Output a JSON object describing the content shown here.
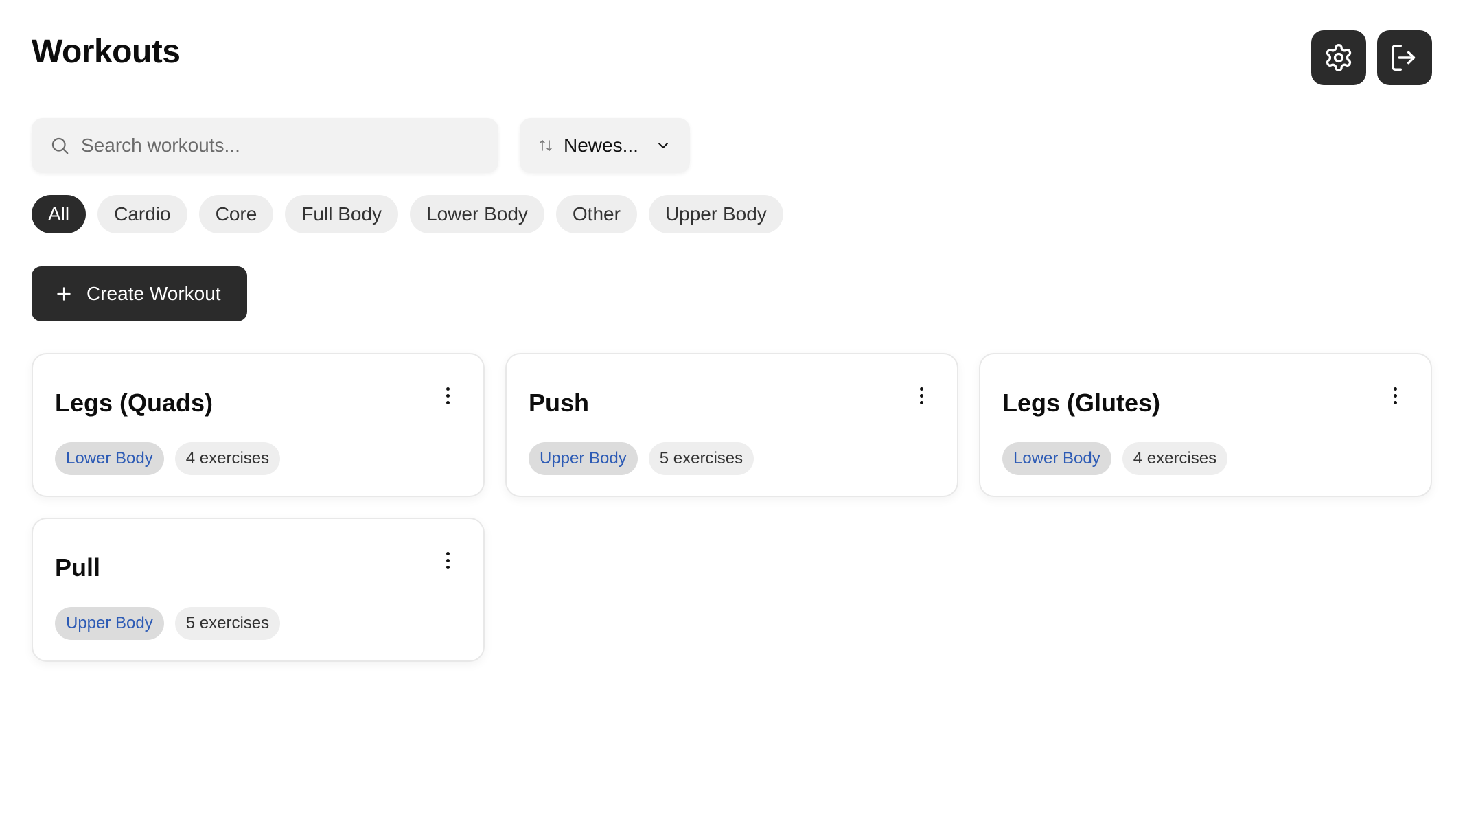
{
  "header": {
    "title": "Workouts",
    "settings_icon": "gear-icon",
    "logout_icon": "logout-icon"
  },
  "search": {
    "placeholder": "Search workouts...",
    "value": ""
  },
  "sort": {
    "label": "Newes..."
  },
  "filters": [
    {
      "label": "All",
      "active": true
    },
    {
      "label": "Cardio",
      "active": false
    },
    {
      "label": "Core",
      "active": false
    },
    {
      "label": "Full Body",
      "active": false
    },
    {
      "label": "Lower Body",
      "active": false
    },
    {
      "label": "Other",
      "active": false
    },
    {
      "label": "Upper Body",
      "active": false
    }
  ],
  "create_button": {
    "label": "Create Workout"
  },
  "workouts": [
    {
      "title": "Legs (Quads)",
      "category": "Lower Body",
      "exercises": "4 exercises"
    },
    {
      "title": "Push",
      "category": "Upper Body",
      "exercises": "5 exercises"
    },
    {
      "title": "Legs (Glutes)",
      "category": "Lower Body",
      "exercises": "4 exercises"
    },
    {
      "title": "Pull",
      "category": "Upper Body",
      "exercises": "5 exercises"
    }
  ],
  "colors": {
    "primary_dark": "#2b2b2b",
    "chip_bg": "#eeeeee",
    "category_text": "#2d5bb5",
    "category_bg": "#dcdcdc"
  }
}
